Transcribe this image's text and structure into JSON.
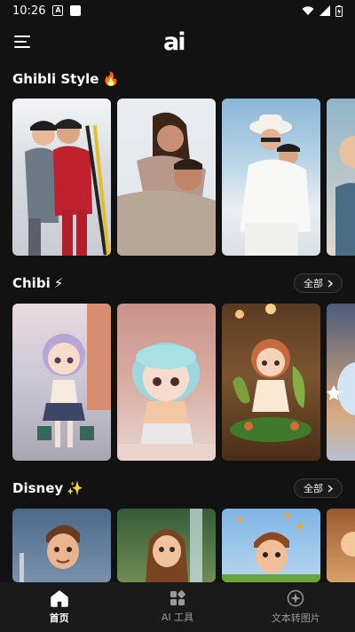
{
  "status_bar": {
    "time": "10:26",
    "notif_letter": "A"
  },
  "logo": "ai",
  "sections": [
    {
      "title": "Ghibli Style",
      "emoji": "🔥",
      "has_all": false
    },
    {
      "title": "Chibi",
      "emoji": "⚡",
      "has_all": true,
      "all_label": "全部"
    },
    {
      "title": "Disney",
      "emoji": "✨",
      "has_all": true,
      "all_label": "全部"
    }
  ],
  "bottom_nav": [
    {
      "label": "首页",
      "icon": "home-icon",
      "active": true
    },
    {
      "label": "AI 工具",
      "icon": "grid-tools-icon",
      "active": false
    },
    {
      "label": "文本转图片",
      "icon": "sparkle-icon",
      "active": false
    }
  ],
  "colors": {
    "background": "#121212",
    "nav_background": "#1a1a1a",
    "active": "#ffffff",
    "inactive": "#9a9a9a"
  }
}
